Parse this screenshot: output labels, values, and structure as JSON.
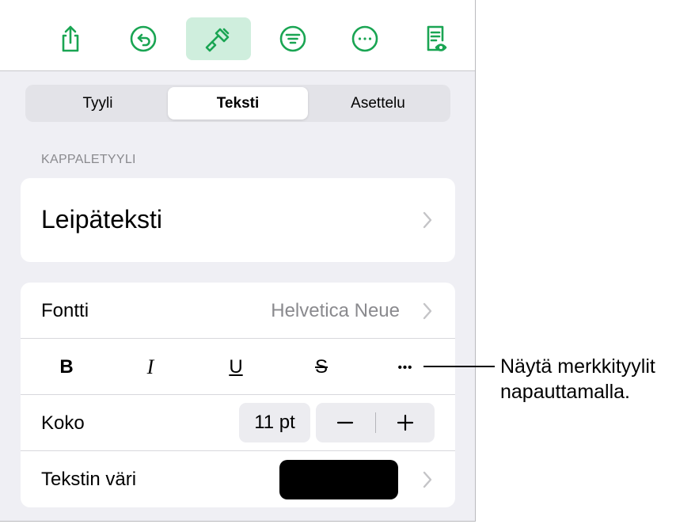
{
  "toolbar": {
    "buttons": [
      {
        "name": "share",
        "icon": "share-icon"
      },
      {
        "name": "undo",
        "icon": "undo-icon"
      },
      {
        "name": "format",
        "icon": "paintbrush-icon",
        "active": true
      },
      {
        "name": "organize",
        "icon": "filter-icon"
      },
      {
        "name": "more",
        "icon": "more-icon"
      },
      {
        "name": "reading-view",
        "icon": "document-eye-icon"
      }
    ],
    "accent_color": "#1aa553",
    "active_bg": "#cfeedd"
  },
  "tabs": [
    {
      "label": "Tyyli",
      "active": false
    },
    {
      "label": "Teksti",
      "active": true
    },
    {
      "label": "Asettelu",
      "active": false
    }
  ],
  "paragraph_style": {
    "section_label": "KAPPALETYYLI",
    "value": "Leipäteksti"
  },
  "font": {
    "label": "Fontti",
    "value": "Helvetica Neue"
  },
  "format_buttons": {
    "bold": "B",
    "italic": "I",
    "underline": "U",
    "strikethrough": "S",
    "more": "•••"
  },
  "size": {
    "label": "Koko",
    "value": "11 pt"
  },
  "text_color": {
    "label": "Tekstin väri",
    "color": "#000000"
  },
  "callout": {
    "text": "Näytä merkkityylit napauttamalla."
  }
}
